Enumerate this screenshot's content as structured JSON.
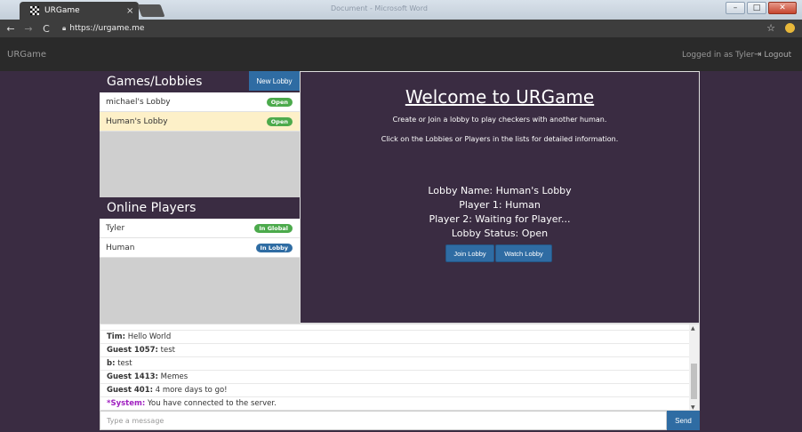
{
  "browser": {
    "tab_title": "URGame",
    "tab_close": "×",
    "window_title": "Document - Microsoft Word",
    "url": "https://urgame.me",
    "win_min": "–",
    "win_max": "□",
    "win_close": "✕"
  },
  "app": {
    "brand": "URGame",
    "logged_in": "Logged in as Tyler",
    "logout": "Logout"
  },
  "lobbies": {
    "header": "Games/Lobbies",
    "new_lobby": "New Lobby",
    "items": [
      {
        "name": "michael's Lobby",
        "status": "Open"
      },
      {
        "name": "Human's Lobby",
        "status": "Open"
      }
    ]
  },
  "players": {
    "header": "Online Players",
    "items": [
      {
        "name": "Tyler",
        "status": "In Global"
      },
      {
        "name": "Human",
        "status": "In Lobby"
      }
    ]
  },
  "main": {
    "welcome": "Welcome to URGame",
    "line1": "Create or Join a lobby to play checkers with another human.",
    "line2": "Click on the Lobbies or Players in the lists for detailed information.",
    "lobby_name": "Lobby Name: Human's Lobby",
    "player1": "Player 1: Human",
    "player2": "Player 2: Waiting for Player...",
    "status": "Lobby Status: Open",
    "join": "Join Lobby",
    "watch": "Watch Lobby"
  },
  "chat": {
    "messages": [
      {
        "who": "Tim",
        "text": "Hello World"
      },
      {
        "who": "Guest 1057",
        "text": "test"
      },
      {
        "who": "b",
        "text": "test"
      },
      {
        "who": "Guest 1413",
        "text": "Memes"
      },
      {
        "who": "Guest 401",
        "text": "4 more days to go!"
      },
      {
        "who": "*System",
        "text": "You have connected to the server."
      }
    ],
    "placeholder": "Type a message",
    "send": "Send"
  },
  "colors": {
    "page_bg": "#3a2c42",
    "accent_blue": "#2f6ca3",
    "badge_green": "#4caa4c",
    "selected_row": "#fdf0c8",
    "system_purple": "#a020c0"
  }
}
